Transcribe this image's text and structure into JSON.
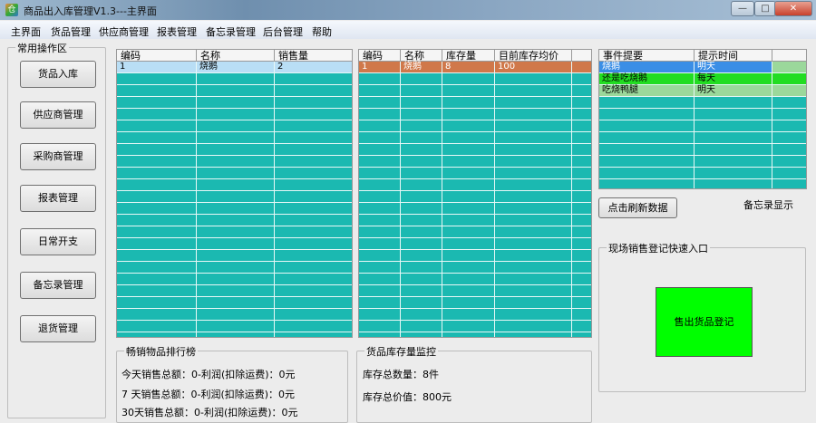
{
  "window": {
    "title": "商品出入库管理V1.3---主界面",
    "app_icon": "app-icon",
    "controls": [
      "minimize",
      "maximize",
      "close"
    ]
  },
  "menu": [
    "主界面",
    "货品管理",
    "供应商管理",
    "报表管理",
    "备忘录管理",
    "后台管理",
    "帮助"
  ],
  "sidebar": {
    "title": "常用操作区",
    "buttons": [
      "货品入库",
      "供应商管理",
      "采购商管理",
      "报表管理",
      "日常开支",
      "备忘录管理",
      "退货管理"
    ]
  },
  "sales_grid": {
    "columns": [
      "编码",
      "名称",
      "销售量"
    ],
    "rows": [
      [
        "1",
        "烧鹅",
        "2"
      ]
    ]
  },
  "stock_grid": {
    "columns": [
      "编码",
      "名称",
      "库存量",
      "目前库存均价",
      ""
    ],
    "rows": [
      [
        "1",
        "烧鹅",
        "8",
        "100",
        ""
      ]
    ]
  },
  "memo_grid": {
    "columns": [
      "事件提要",
      "提示时间",
      ""
    ],
    "rows": [
      [
        "烧鹅",
        "明天"
      ],
      [
        "还是吃烧鹅",
        "每天"
      ],
      [
        "吃烧鸭腿",
        "明天"
      ]
    ]
  },
  "refresh_button": "点击刷新数据",
  "memo_label": "备忘录显示",
  "quick_sale": {
    "title": "现场销售登记快速入口",
    "button": "售出货品登记",
    "button_color": "#00ff00"
  },
  "ranking": {
    "title": "畅销物品排行榜",
    "lines": [
      "今天销售总额：0-利润(扣除运费)：0元",
      "7 天销售总额：0-利润(扣除运费)：0元",
      "30天销售总额：0-利润(扣除运费)：0元"
    ]
  },
  "inventory": {
    "title": "货品库存量监控",
    "lines": [
      "库存总数量：8件",
      "库存总价值：800元"
    ]
  }
}
